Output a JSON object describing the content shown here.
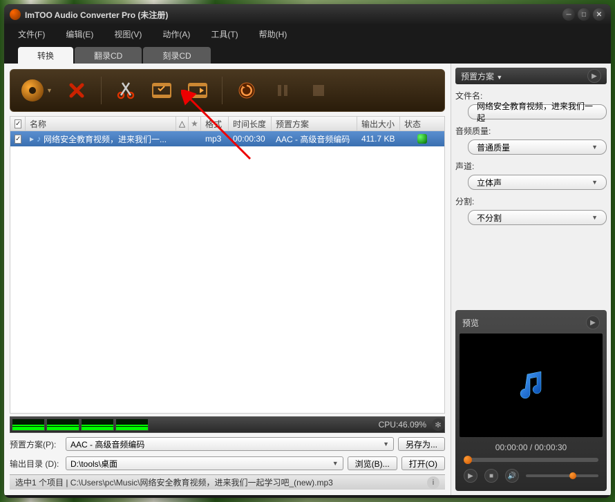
{
  "title": "ImTOO Audio Converter Pro (未注册)",
  "menubar": [
    "文件(F)",
    "编辑(E)",
    "视图(V)",
    "动作(A)",
    "工具(T)",
    "帮助(H)"
  ],
  "tabs": [
    "转换",
    "翻录CD",
    "刻录CD"
  ],
  "activeTab": 0,
  "listHeaders": {
    "name": "名称",
    "format": "格式",
    "duration": "时间长度",
    "preset": "预置方案",
    "outsize": "输出大小",
    "status": "状态"
  },
  "rows": [
    {
      "name": "网络安全教育视频，进来我们一...",
      "format": "mp3",
      "duration": "00:00:30",
      "preset": "AAC - 高级音频编码",
      "outsize": "411.7 KB"
    }
  ],
  "cpu": "CPU:46.09%",
  "bottom": {
    "presetLabel": "预置方案(P):",
    "presetValue": "AAC - 高级音频编码",
    "saveAs": "另存为...",
    "outdirLabel": "输出目录 (D):",
    "outdirValue": "D:\\tools\\桌面",
    "browse": "浏览(B)...",
    "open": "打开(O)"
  },
  "statusbar": "选中1 个项目 | C:\\Users\\pc\\Music\\网络安全教育视频，进来我们一起学习吧_(new).mp3",
  "right": {
    "presetHeader": "预置方案",
    "filenameLabel": "文件名:",
    "filenameValue": "网络安全教育视频，进来我们一起",
    "qualityLabel": "音频质量:",
    "qualityValue": "普通质量",
    "channelLabel": "声道:",
    "channelValue": "立体声",
    "splitLabel": "分割:",
    "splitValue": "不分割",
    "previewLabel": "预览",
    "timeText": "00:00:00 / 00:00:30"
  }
}
